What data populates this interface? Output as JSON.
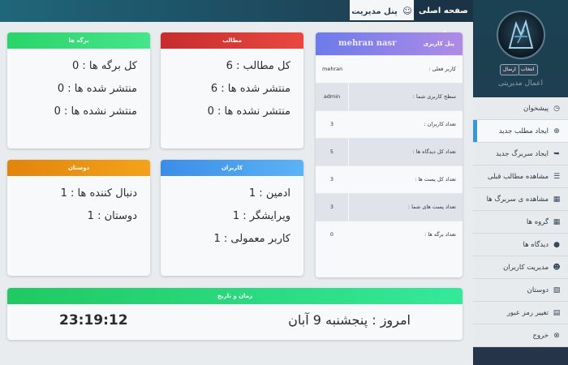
{
  "header": {
    "tabs": [
      {
        "label": "صفحه اصلی",
        "icon": "home-icon"
      },
      {
        "label": "پنل مدیریت",
        "icon": "user-circle-icon"
      }
    ]
  },
  "sidebar": {
    "choose_label": "انتخاب",
    "send_label": "ارسال",
    "title": "اعمال مدیریتی",
    "items": [
      {
        "label": "پیشخوان",
        "icon": "dashboard-icon"
      },
      {
        "label": "ایجاد مطلب جدید",
        "icon": "plus-circle-icon"
      },
      {
        "label": "ایجاد سربرگ جدید",
        "icon": "new-page-icon"
      },
      {
        "label": "مشاهده مطالب قبلی",
        "icon": "list-icon"
      },
      {
        "label": "مشاهده ی سربرگ ها",
        "icon": "pages-icon"
      },
      {
        "label": "گروه ها",
        "icon": "grid-icon"
      },
      {
        "label": "دیدگاه ها",
        "icon": "comment-icon"
      },
      {
        "label": "مدیریت کاربران",
        "icon": "users-icon"
      },
      {
        "label": "دوستان",
        "icon": "contact-book-icon"
      },
      {
        "label": "تغییر رمز عبور",
        "icon": "lock-file-icon"
      },
      {
        "label": "خروج",
        "icon": "close-circle-icon"
      }
    ]
  },
  "cards": {
    "pages": {
      "title": "برگه ها",
      "lines": [
        "کل برگه ها : 0",
        "منتشر شده ها : 0",
        "منتشر نشده ها : 0"
      ]
    },
    "posts": {
      "title": "مطالب",
      "lines": [
        "کل مطالب : 6",
        "منتشر شده ها : 6",
        "منتشر نشده ها : 0"
      ]
    },
    "friends": {
      "title": "دوستان",
      "lines": [
        "دنبال کننده ها : 1",
        "دوستان : 1"
      ]
    },
    "users": {
      "title": "کاربران",
      "lines": [
        "ادمین : 1",
        "ویرایشگر : 1",
        "کاربر معمولی : 1"
      ]
    },
    "datetime": {
      "title": "زمان و تاریخ",
      "date_text": "امروز : پنجشنبه 9 آبان",
      "time_text": "23:19:12"
    }
  },
  "user_panel": {
    "title": "پنل کاربری",
    "name": "mehran nasr",
    "rows": [
      {
        "label": "کاربر فعلی :",
        "value": "mehran"
      },
      {
        "label": "سطح کاربری شما :",
        "value": "admin"
      },
      {
        "label": "تعداد کاربران :",
        "value": "3"
      },
      {
        "label": "تعداد کل دیدگاه ها :",
        "value": "5"
      },
      {
        "label": "تعداد کل پست ها :",
        "value": "3"
      },
      {
        "label": "تعداد پست های شما :",
        "value": "3"
      },
      {
        "label": "تعداد برگه ها :",
        "value": "0"
      }
    ]
  }
}
